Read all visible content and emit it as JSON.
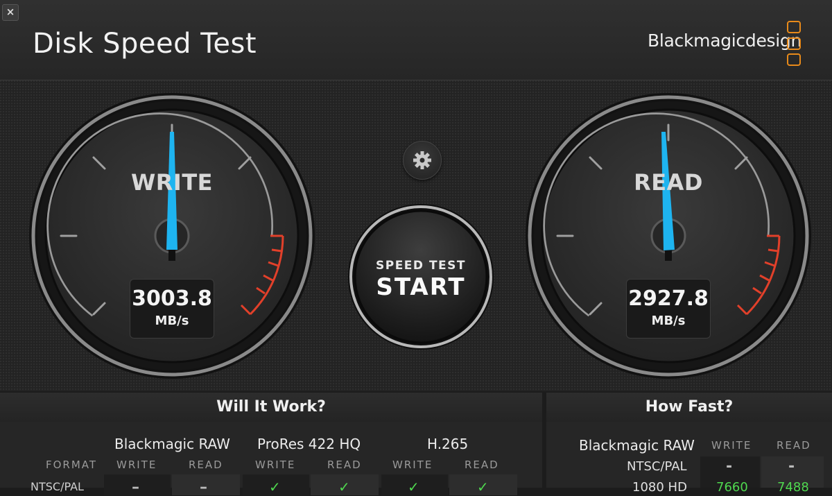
{
  "window": {
    "close_glyph": "×"
  },
  "header": {
    "title": "Disk Speed Test",
    "brand": "Blackmagicdesign"
  },
  "gauges": {
    "write": {
      "label": "WRITE",
      "value": "3003.8",
      "unit": "MB/s"
    },
    "read": {
      "label": "READ",
      "value": "2927.8",
      "unit": "MB/s"
    }
  },
  "start_button": {
    "line1": "SPEED TEST",
    "line2": "START"
  },
  "will_it_work": {
    "title": "Will It Work?",
    "format_header": "FORMAT",
    "codecs": [
      "Blackmagic RAW",
      "ProRes 422 HQ",
      "H.265"
    ],
    "sub_headers": [
      "WRITE",
      "READ"
    ],
    "rows": [
      {
        "format": "NTSC/PAL",
        "cells": [
          "–",
          "–",
          "✓",
          "✓",
          "✓",
          "✓"
        ]
      }
    ]
  },
  "how_fast": {
    "title": "How Fast?",
    "codec": "Blackmagic RAW",
    "sub_headers": [
      "WRITE",
      "READ"
    ],
    "rows": [
      {
        "format": "NTSC/PAL",
        "write": "-",
        "read": "-"
      },
      {
        "format": "1080 HD",
        "write": "7660",
        "read": "7488"
      }
    ]
  },
  "colors": {
    "needle": "#1eb4f0",
    "redline": "#e2402a",
    "check": "#4fd84f",
    "logo": "#e88a1a"
  }
}
